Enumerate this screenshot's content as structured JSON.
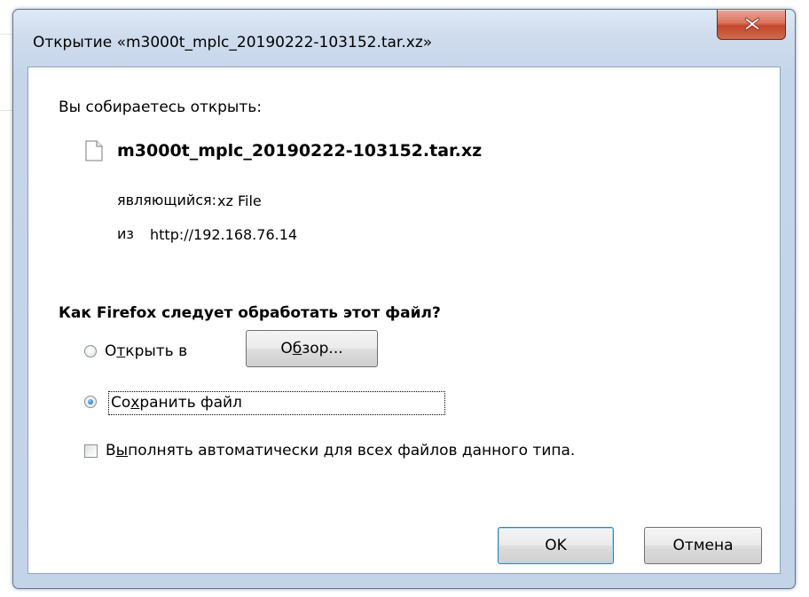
{
  "dialog": {
    "title": "Открытие «m3000t_mplc_20190222-103152.tar.xz»",
    "close_icon": "close-x-icon"
  },
  "content": {
    "intro": "Вы собираетесь открыть:",
    "file_icon": "document-icon",
    "file_name": "m3000t_mplc_20190222-103152.tar.xz",
    "type_label": "являющийся:",
    "type_value": "xz File",
    "from_label": "из",
    "from_value": "http://192.168.76.14",
    "question": "Как Firefox следует обработать этот файл?"
  },
  "options": {
    "open_with": {
      "label_pre": "О",
      "label_accel": "т",
      "label_post": "крыть в",
      "checked": false
    },
    "browse_button": {
      "label_pre": "О",
      "label_accel": "б",
      "label_post": "зор..."
    },
    "save_file": {
      "label_pre": "Со",
      "label_accel": "х",
      "label_post": "ранить файл",
      "checked": true
    },
    "auto_action": {
      "label_pre": "В",
      "label_accel": "ы",
      "label_post": "полнять автоматически для всех файлов данного типа.",
      "checked": false
    }
  },
  "buttons": {
    "ok": "OK",
    "cancel": "Отмена"
  }
}
